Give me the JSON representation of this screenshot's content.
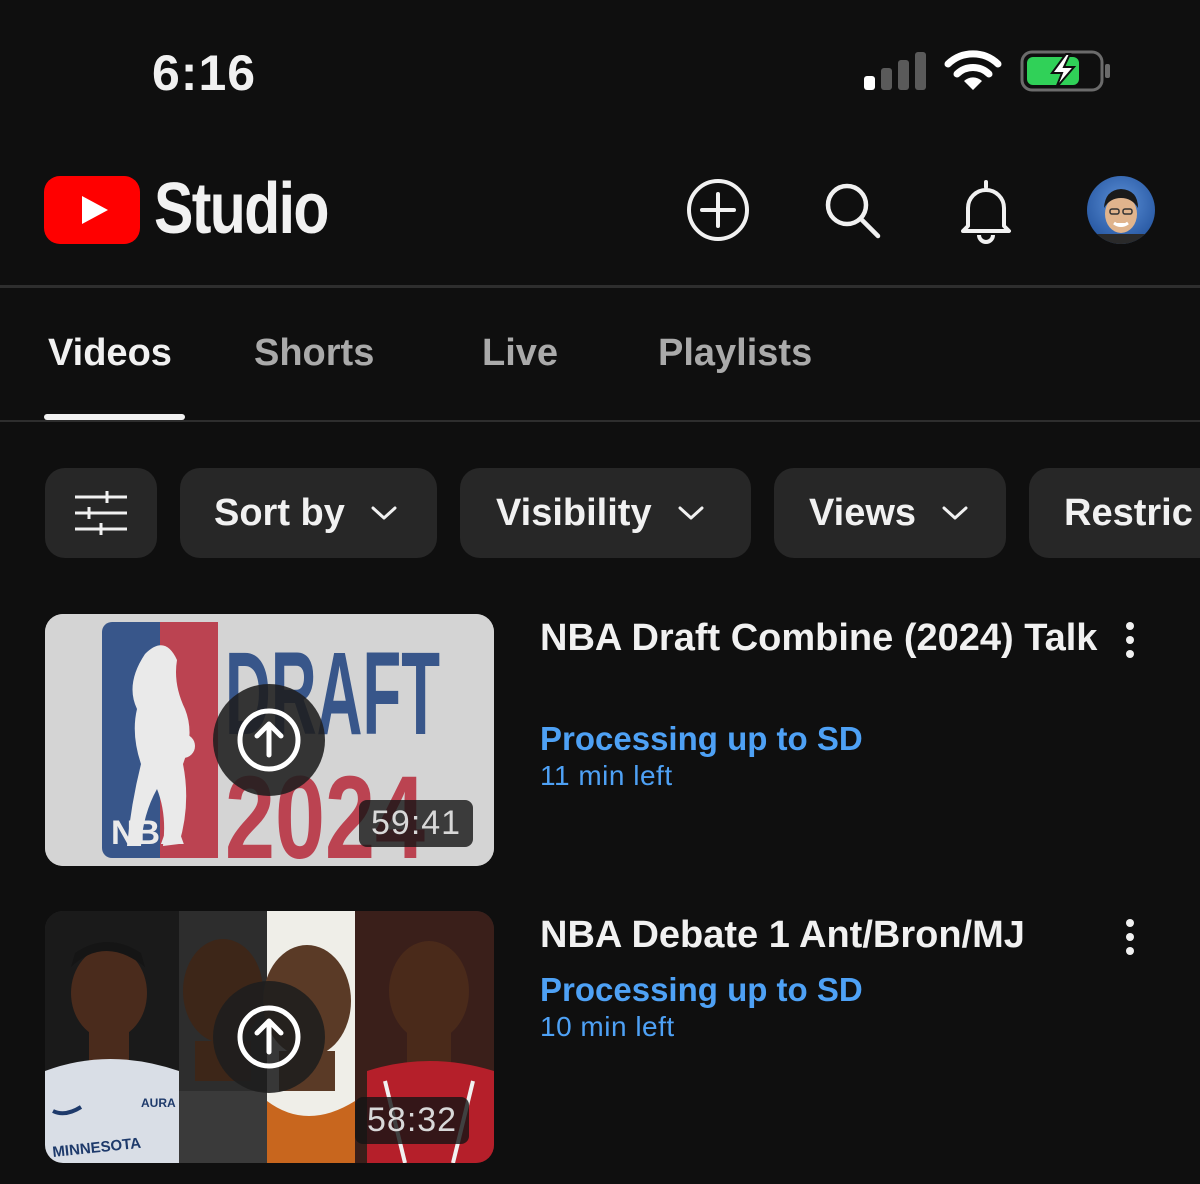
{
  "status_bar": {
    "time": "6:16"
  },
  "header": {
    "logo_text": "Studio"
  },
  "tabs": [
    {
      "label": "Videos",
      "active": true
    },
    {
      "label": "Shorts",
      "active": false
    },
    {
      "label": "Live",
      "active": false
    },
    {
      "label": "Playlists",
      "active": false
    }
  ],
  "filters": {
    "icon": "filter-sliders-icon",
    "chips": [
      {
        "label": "Sort by"
      },
      {
        "label": "Visibility"
      },
      {
        "label": "Views"
      },
      {
        "label": "Restric"
      }
    ]
  },
  "videos": [
    {
      "title": "NBA Draft Combine (2024) Talk",
      "status": "Processing up to SD",
      "time_left": "11 min left",
      "duration": "59:41",
      "thumbnail_text": {
        "logo": "NBA",
        "headline": "DRAFT",
        "year": "2024"
      }
    },
    {
      "title": "NBA Debate 1 Ant/Bron/MJ",
      "status": "Processing up to SD",
      "time_left": "10 min left",
      "duration": "58:32",
      "thumbnail_text": {
        "jersey": "MINNESOTA",
        "patch": "AURA"
      }
    }
  ],
  "colors": {
    "background": "#0f0f0f",
    "youtube_red": "#ff0000",
    "processing_blue": "#4ea1f5",
    "chip_bg": "#272727",
    "battery_green": "#30d158"
  }
}
